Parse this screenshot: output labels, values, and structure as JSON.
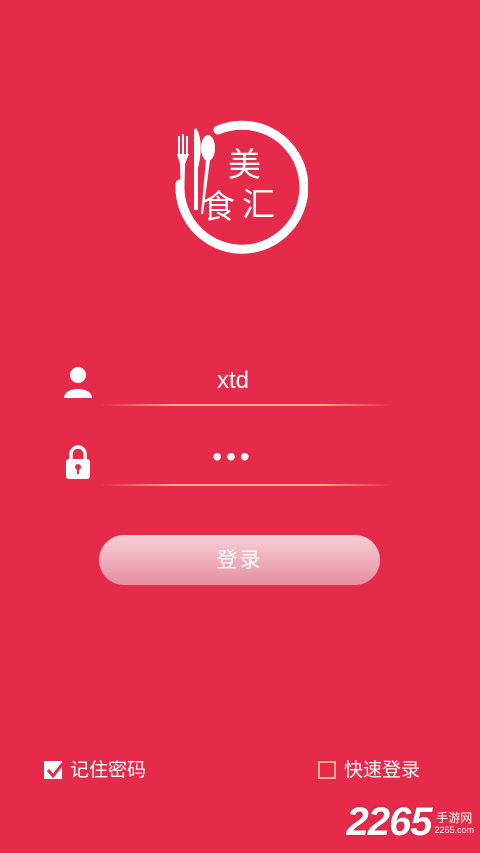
{
  "colors": {
    "background": "#E62B4A",
    "field_underline": "#F4B181",
    "button_top": "#F7D0D7",
    "button_bottom": "#E68EA0"
  },
  "logo": {
    "chars": [
      "美",
      "食",
      "汇"
    ],
    "icons": [
      "fork-icon",
      "knife-icon",
      "spoon-icon"
    ]
  },
  "login_form": {
    "username": {
      "icon": "user-icon",
      "value": "xtd"
    },
    "password": {
      "icon": "lock-icon",
      "value": "•••"
    },
    "login_label": "登录"
  },
  "options": {
    "remember_password": {
      "label": "记住密码",
      "checked": true
    },
    "quick_login": {
      "label": "快速登录",
      "checked": false
    }
  },
  "watermark": {
    "number": "2265",
    "text": "手游网",
    "url": "2265.com"
  }
}
